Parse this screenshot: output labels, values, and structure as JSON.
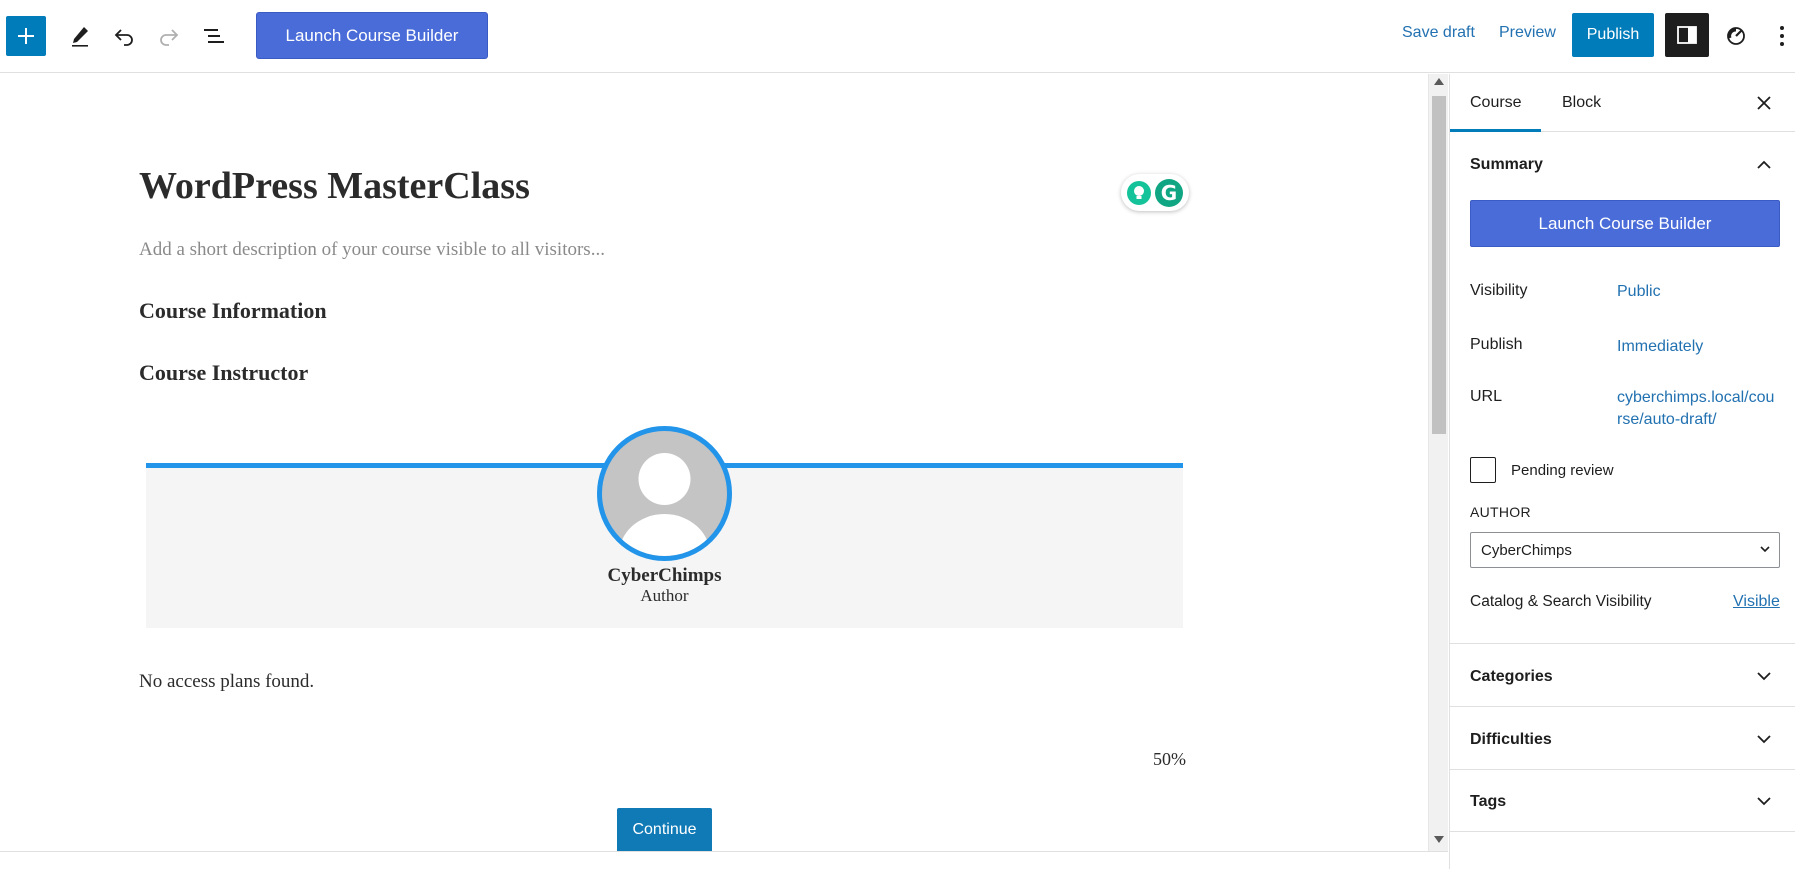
{
  "toolbar": {
    "launch_label": "Launch Course Builder",
    "save_draft": "Save draft",
    "preview": "Preview",
    "publish": "Publish"
  },
  "post": {
    "title": "WordPress MasterClass",
    "description_placeholder": "Add a short description of your course visible to all visitors...",
    "heading_info": "Course Information",
    "heading_instructor": "Course Instructor",
    "instructor_name": "CyberChimps",
    "instructor_role": "Author",
    "no_access": "No access plans found.",
    "progress": "50%",
    "continue": "Continue"
  },
  "sidebar": {
    "tabs": [
      "Course",
      "Block"
    ],
    "summary_title": "Summary",
    "launch_label": "Launch Course Builder",
    "visibility_label": "Visibility",
    "visibility_value": "Public",
    "publish_label": "Publish",
    "publish_value": "Immediately",
    "url_label": "URL",
    "url_value": "cyberchimps.local/course/auto-draft/",
    "pending_review": "Pending review",
    "author_label": "AUTHOR",
    "author_value": "CyberChimps",
    "catalog_label": "Catalog & Search Visibility",
    "catalog_value": "Visible",
    "categories": "Categories",
    "difficulties": "Difficulties",
    "tags": "Tags"
  },
  "colors": {
    "accent": "#007cba",
    "launch_button": "#4a6cd8",
    "instructor_border": "#2295ea",
    "link": "#2271b1"
  }
}
